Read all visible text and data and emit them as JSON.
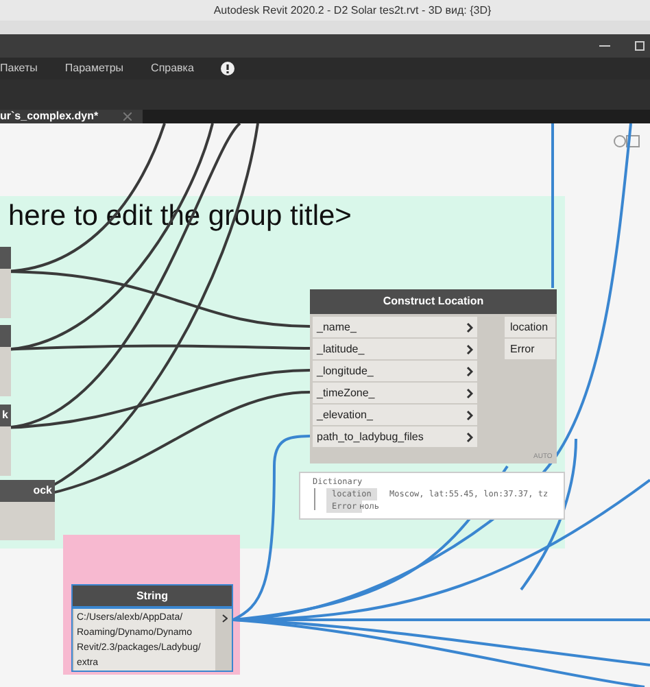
{
  "window": {
    "title": "Autodesk Revit 2020.2 - D2 Solar tes2t.rvt - 3D вид: {3D}"
  },
  "menu": [
    "Пакеты",
    "Параметры",
    "Справка"
  ],
  "tab": {
    "label": "ur`s_complex.dyn*",
    "selected": true
  },
  "group": {
    "title": "here to edit the group title>"
  },
  "left_nodes": [
    {
      "kind": "untitled"
    },
    {
      "kind": "untitled"
    },
    {
      "kind": "titled",
      "title": "k"
    },
    {
      "kind": "titled",
      "title": "ock"
    }
  ],
  "construct_node": {
    "title": "Construct Location",
    "inputs": [
      "_name_",
      "_latitude_",
      "_longitude_",
      "_timeZone_",
      "_elevation_",
      "path_to_ladybug_files"
    ],
    "outputs": [
      "location",
      "Error"
    ],
    "lacing": "AUTO"
  },
  "preview": {
    "type": "Dictionary",
    "entries": [
      {
        "key": "location",
        "value": "Moscow, lat:55.45, lon:37.37, tz"
      },
      {
        "key": "Error",
        "value": "ноль"
      }
    ]
  },
  "string_node": {
    "title": "String",
    "value_lines": [
      "C:/Users/alexb/AppData/",
      "Roaming/Dynamo/Dynamo",
      "Revit/2.3/packages/Ladybug/",
      "extra"
    ],
    "selected": true
  }
}
